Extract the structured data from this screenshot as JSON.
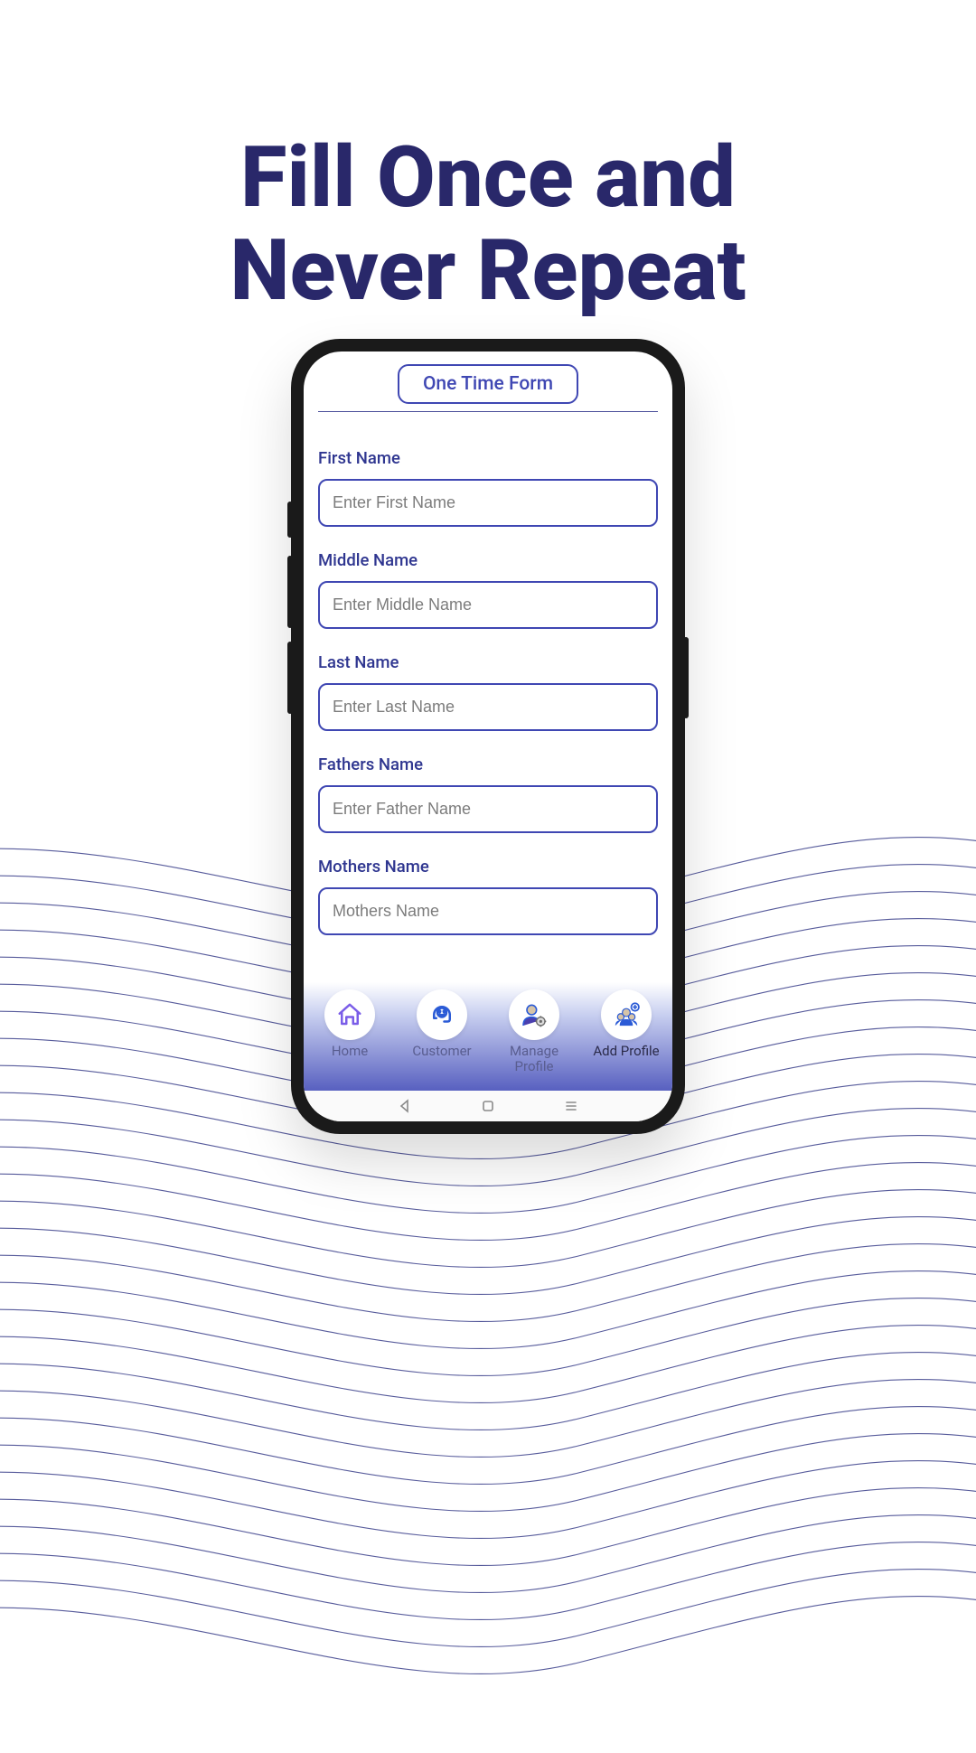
{
  "headline_line1": "Fill Once and",
  "headline_line2": "Never Repeat",
  "form": {
    "title": "One Time Form",
    "fields": [
      {
        "label": "First Name",
        "placeholder": "Enter First Name",
        "value": ""
      },
      {
        "label": "Middle Name",
        "placeholder": "Enter Middle Name",
        "value": ""
      },
      {
        "label": "Last Name",
        "placeholder": "Enter Last Name",
        "value": ""
      },
      {
        "label": "Fathers Name",
        "placeholder": "Enter Father Name",
        "value": ""
      },
      {
        "label": "Mothers Name",
        "placeholder": "Mothers Name",
        "value": ""
      }
    ],
    "cutoff_text": "No"
  },
  "nav": {
    "items": [
      {
        "label": "Home"
      },
      {
        "label": "Customer"
      },
      {
        "label": "Manage\nProfile"
      },
      {
        "label": "Add Profile"
      }
    ]
  },
  "colors": {
    "primary": "#29286a",
    "accent": "#3f47b3"
  }
}
